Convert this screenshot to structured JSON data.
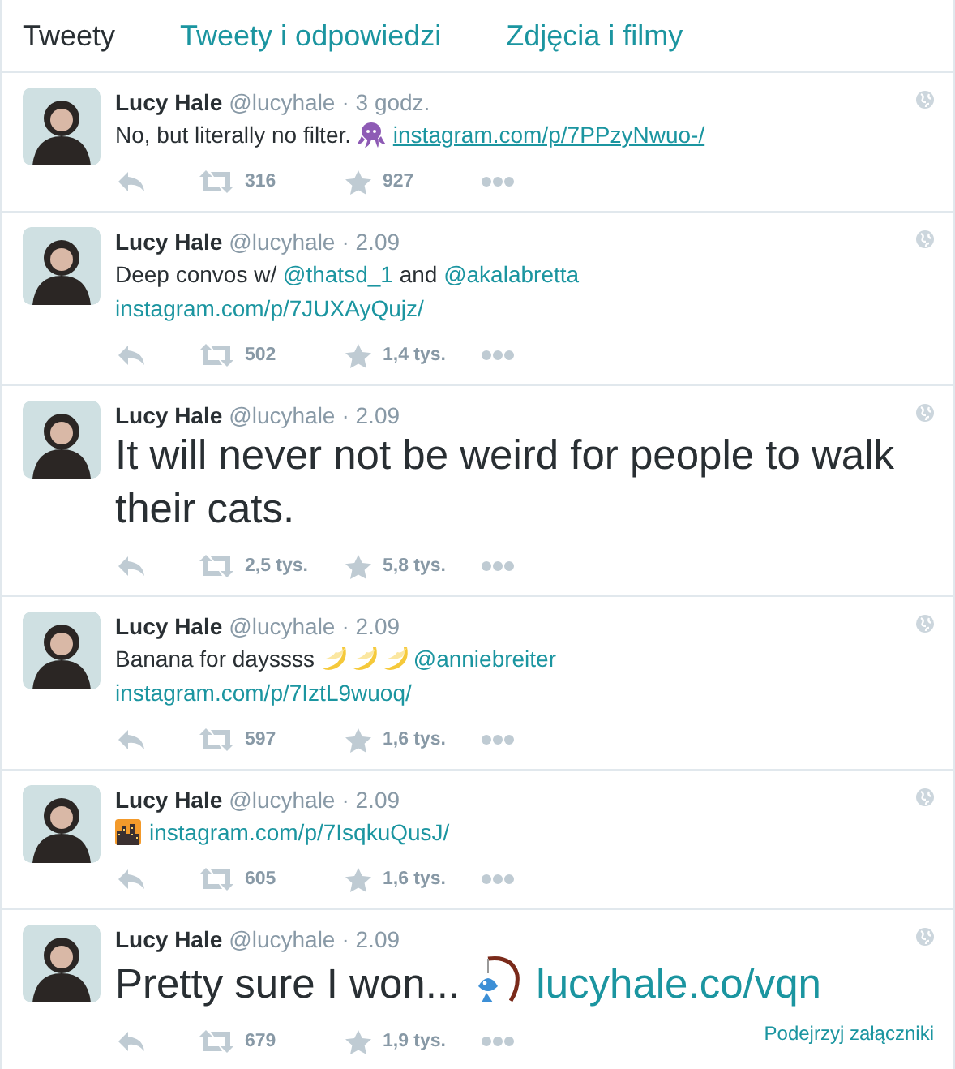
{
  "tabs": [
    {
      "label": "Tweety",
      "selected": true
    },
    {
      "label": "Tweety i odpowiedzi",
      "selected": false
    },
    {
      "label": "Zdjęcia i filmy",
      "selected": false
    }
  ],
  "tweets": [
    {
      "name": "Lucy Hale",
      "handle": "@lucyhale",
      "time": "· 3 godz.",
      "large": false,
      "text": [
        {
          "kind": "text",
          "value": "No, but literally no filter. "
        },
        {
          "kind": "octopus"
        },
        {
          "kind": "link",
          "value": "instagram.com/p/7PPzyNwuo-/",
          "underlined": true
        }
      ],
      "retweets": "316",
      "favorites": "927"
    },
    {
      "name": "Lucy Hale",
      "handle": "@lucyhale",
      "time": "· 2.09",
      "large": false,
      "text": [
        {
          "kind": "text",
          "value": "Deep convos w/ "
        },
        {
          "kind": "link",
          "value": "@thatsd_1",
          "underlined": false
        },
        {
          "kind": "text",
          "value": " and "
        },
        {
          "kind": "link",
          "value": "@akalabretta",
          "underlined": false
        },
        {
          "kind": "break"
        },
        {
          "kind": "link",
          "value": "instagram.com/p/7JUXAyQujz/",
          "underlined": false
        }
      ],
      "retweets": "502",
      "favorites": "1,4 tys."
    },
    {
      "name": "Lucy Hale",
      "handle": "@lucyhale",
      "time": "· 2.09",
      "large": true,
      "text": [
        {
          "kind": "text",
          "value": "It will never not be weird for people to walk their cats."
        }
      ],
      "retweets": "2,5 tys.",
      "favorites": "5,8 tys."
    },
    {
      "name": "Lucy Hale",
      "handle": "@lucyhale",
      "time": "· 2.09",
      "large": false,
      "text": [
        {
          "kind": "text",
          "value": "Banana for dayssss "
        },
        {
          "kind": "banana"
        },
        {
          "kind": "banana"
        },
        {
          "kind": "banana"
        },
        {
          "kind": "link",
          "value": "@anniebreiter",
          "underlined": false
        },
        {
          "kind": "break"
        },
        {
          "kind": "link",
          "value": "instagram.com/p/7IztL9wuoq/",
          "underlined": false
        }
      ],
      "retweets": "597",
      "favorites": "1,6 tys."
    },
    {
      "name": "Lucy Hale",
      "handle": "@lucyhale",
      "time": "· 2.09",
      "large": false,
      "text": [
        {
          "kind": "city"
        },
        {
          "kind": "link",
          "value": "instagram.com/p/7IsqkuQusJ/",
          "underlined": false
        }
      ],
      "retweets": "605",
      "favorites": "1,6 tys."
    },
    {
      "name": "Lucy Hale",
      "handle": "@lucyhale",
      "time": "· 2.09",
      "large": true,
      "text": [
        {
          "kind": "text",
          "value": "Pretty sure I won... "
        },
        {
          "kind": "fishing"
        },
        {
          "kind": "link",
          "value": "lucyhale.co/vqn",
          "underlined": false
        }
      ],
      "retweets": "679",
      "favorites": "1,9 tys.",
      "attachments_link": "Podejrzyj załączniki"
    }
  ]
}
